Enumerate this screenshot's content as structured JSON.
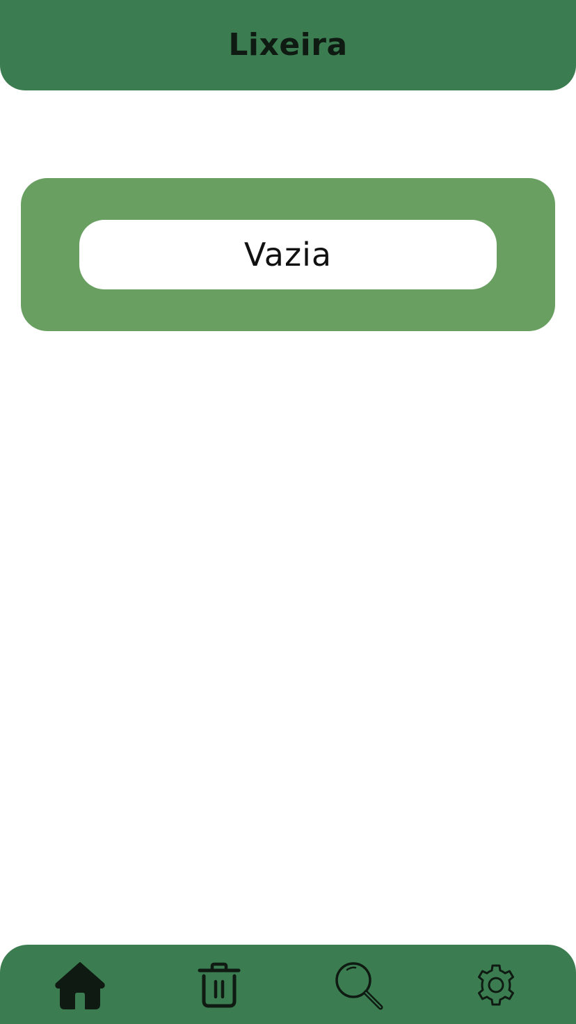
{
  "header": {
    "title": "Lixeira"
  },
  "content": {
    "empty_label": "Vazia"
  },
  "nav": {
    "items": [
      {
        "icon": "home-icon",
        "active": true
      },
      {
        "icon": "trash-icon",
        "active": false
      },
      {
        "icon": "search-icon",
        "active": false
      },
      {
        "icon": "gear-icon",
        "active": false
      }
    ]
  },
  "colors": {
    "header_bg": "#3b7c50",
    "card_bg": "#69a062",
    "icon": "#0e1a12",
    "page_bg": "#ffffff"
  }
}
